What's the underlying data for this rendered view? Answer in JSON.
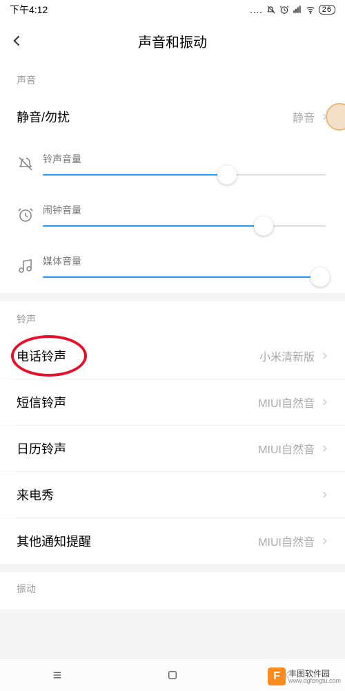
{
  "statusbar": {
    "time": "下午4:12",
    "battery": "26"
  },
  "header": {
    "title": "声音和振动"
  },
  "sound": {
    "section_label": "声音",
    "silent": {
      "label": "静音/勿扰",
      "value": "静音"
    },
    "sliders": {
      "ringer": {
        "label": "铃声音量",
        "pct": 65
      },
      "alarm": {
        "label": "闹钟音量",
        "pct": 78
      },
      "media": {
        "label": "媒体音量",
        "pct": 98
      }
    }
  },
  "ringtone": {
    "section_label": "铃声",
    "items": {
      "phone": {
        "label": "电话铃声",
        "value": "小米清新版"
      },
      "sms": {
        "label": "短信铃声",
        "value": "MIUI自然音"
      },
      "calendar": {
        "label": "日历铃声",
        "value": "MIUI自然音"
      },
      "callershow": {
        "label": "来电秀",
        "value": ""
      },
      "other": {
        "label": "其他通知提醒",
        "value": "MIUI自然音"
      }
    }
  },
  "vibration": {
    "section_label": "振动"
  },
  "watermark": {
    "brand": "丰图软件园",
    "url": "www.dgfengtu.com"
  }
}
